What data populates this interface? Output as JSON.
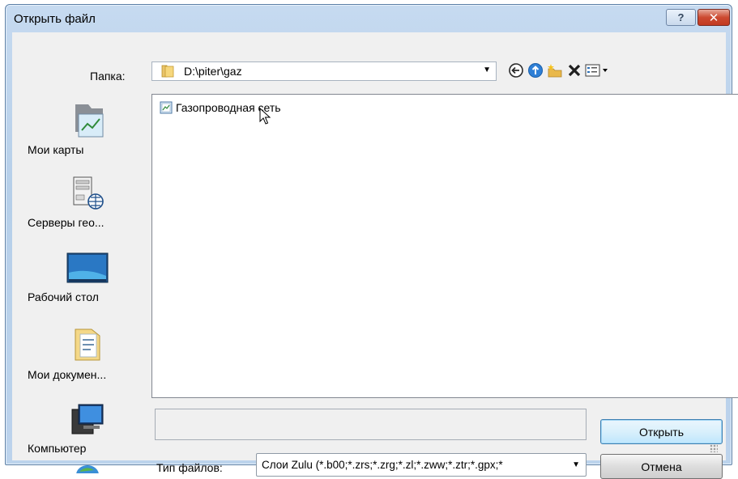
{
  "window": {
    "title": "Открыть файл",
    "help_label": "?",
    "close_label": "✕"
  },
  "folder": {
    "label": "Папка:",
    "path": "D:\\piter\\gaz"
  },
  "toolbar": {
    "icons": [
      "back-icon",
      "up-folder-icon",
      "new-folder-icon",
      "delete-icon",
      "view-menu-icon"
    ]
  },
  "places": [
    {
      "label": "Мои карты",
      "icon": "my-maps-icon"
    },
    {
      "label": "Серверы гео...",
      "icon": "geo-servers-icon"
    },
    {
      "label": "Рабочий стол",
      "icon": "desktop-icon"
    },
    {
      "label": "Мои докумен...",
      "icon": "my-documents-icon"
    },
    {
      "label": "Компьютер",
      "icon": "computer-icon"
    }
  ],
  "files": [
    {
      "name": "Газопроводная сеть",
      "icon": "map-file-icon"
    }
  ],
  "filename": {
    "value": ""
  },
  "filetype": {
    "label": "Тип файлов:",
    "value": "Слои Zulu (*.b00;*.zrs;*.zrg;*.zl;*.zww;*.ztr;*.gpx;*"
  },
  "buttons": {
    "open": "Открыть",
    "cancel": "Отмена"
  },
  "colors": {
    "title_bar": "#b9d1ea",
    "close_button": "#c6402a",
    "default_button_border": "#3c7fb1"
  }
}
